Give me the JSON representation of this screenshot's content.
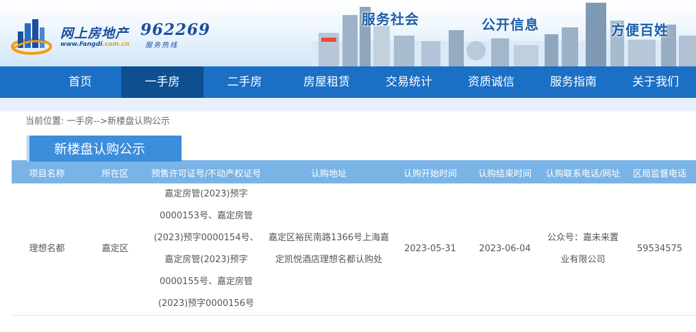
{
  "header": {
    "logo_text": "网上房地产",
    "logo_url_prefix": "www.Fangdi",
    "logo_url_suffix": ".com.cn",
    "hotline_number": "962269",
    "hotline_label": "服务热线",
    "slogans": [
      "服务社会",
      "公开信息",
      "方便百姓"
    ]
  },
  "nav": {
    "items": [
      "首页",
      "一手房",
      "二手房",
      "房屋租赁",
      "交易统计",
      "资质诚信",
      "服务指南",
      "关于我们"
    ],
    "active_index": 1
  },
  "breadcrumb": {
    "prefix": "当前位置: ",
    "level1": "一手房",
    "separator": "-->",
    "level2": "新楼盘认购公示"
  },
  "section": {
    "title": "新楼盘认购公示"
  },
  "table": {
    "headers": [
      "项目名称",
      "所在区",
      "预售许可证号/不动产权证号",
      "认购地址",
      "认购开始时间",
      "认购结束时间",
      "认购联系电话/网址",
      "区局监督电话"
    ],
    "rows": [
      {
        "project": "理想名都",
        "district": "嘉定区",
        "permit": "嘉定房管(2023)预字0000153号、嘉定房管(2023)预字0000154号、嘉定房管(2023)预字0000155号、嘉定房管(2023)预字0000156号",
        "address": "嘉定区裕民南路1366号上海嘉定凯悦酒店理想名都认购处",
        "start": "2023-05-31",
        "end": "2023-06-04",
        "contact": "公众号：嘉未来置业有限公司",
        "phone": "59534575"
      }
    ]
  },
  "colors": {
    "nav_bg": "#1b6fc4",
    "nav_active": "#0d4f8f",
    "table_header": "#7ab4e6",
    "section_tab": "#3c8ddb"
  }
}
